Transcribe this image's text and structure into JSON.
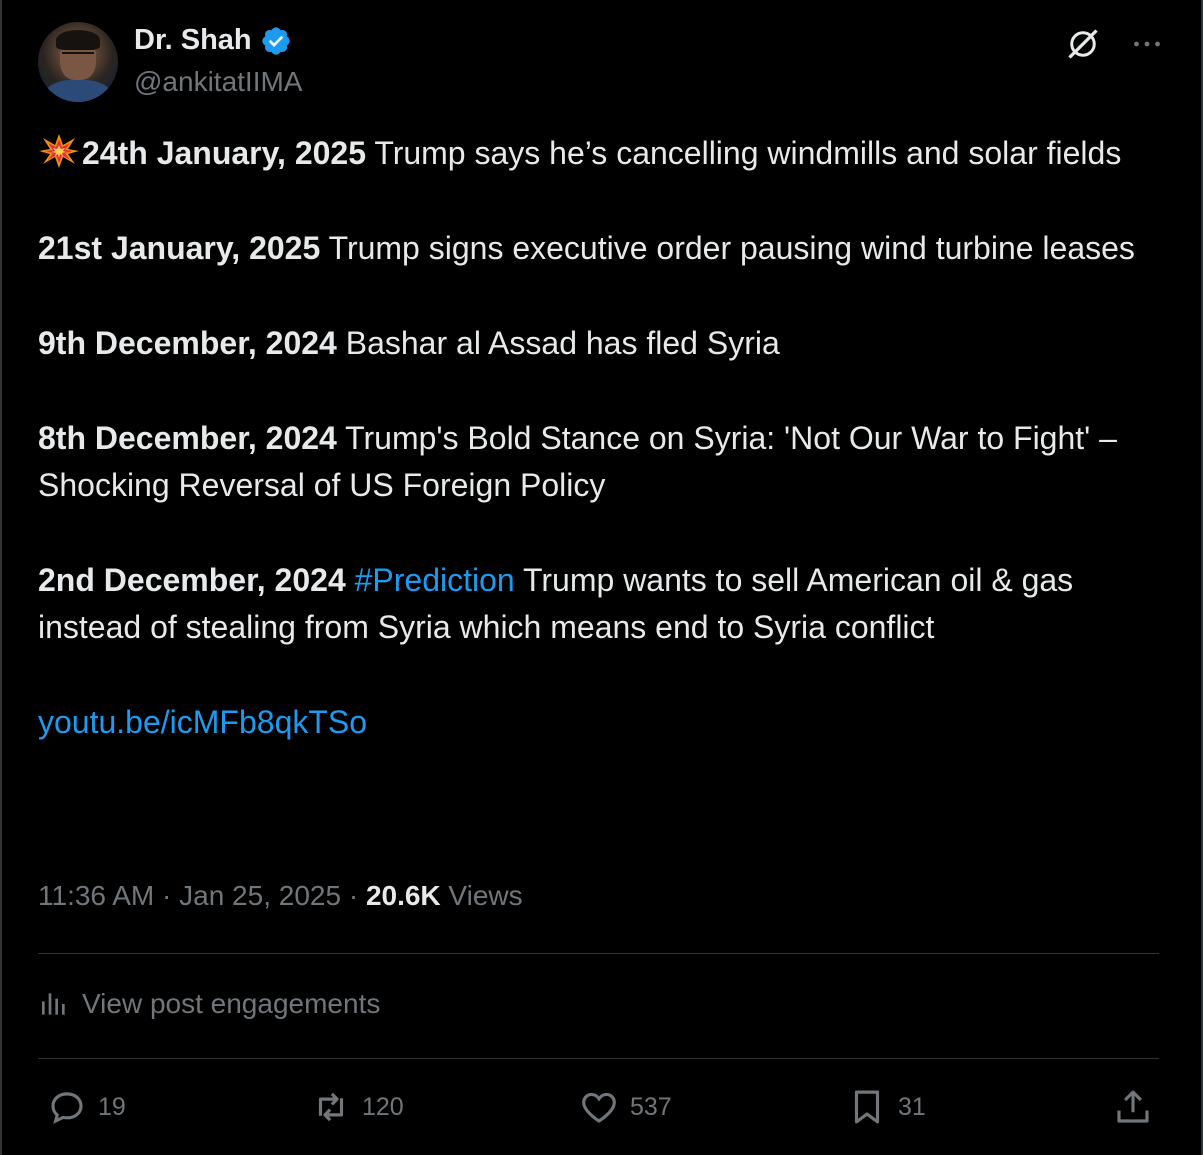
{
  "author": {
    "name": "Dr. Shah",
    "handle": "@ankitatIIMA",
    "verified": true
  },
  "header_icons": [
    "avatar",
    "verified-badge-icon",
    "grok-icon",
    "more-icon"
  ],
  "post": {
    "lines": [
      {
        "date": "24th January, 2025",
        "text": " Trump says he’s cancelling windmills and solar fields",
        "emoji": "collision"
      },
      {
        "date": "21st January, 2025",
        "text": " Trump signs executive order pausing wind turbine leases"
      },
      {
        "date": "9th December, 2024",
        "text": " Bashar al Assad has fled Syria"
      },
      {
        "date": "8th December, 2024",
        "text": " Trump's Bold Stance on Syria: 'Not Our War to Fight' – Shocking Reversal of US Foreign Policy"
      },
      {
        "date": "2nd December, 2024",
        "hashtag": " #Prediction",
        "text": " Trump wants to sell American oil & gas instead of stealing from Syria which means end to Syria conflict"
      }
    ],
    "link": "youtu.be/icMFb8qkTSo"
  },
  "meta": {
    "time": "11:36 AM",
    "sep1": " · ",
    "date": "Jan 25, 2025",
    "sep2": " · ",
    "views_count": "20.6K",
    "views_label": " Views"
  },
  "engagements_label": "View post engagements",
  "actions": {
    "replies": "19",
    "reposts": "120",
    "likes": "537",
    "bookmarks": "31"
  },
  "colors": {
    "background": "#000000",
    "text": "#e7e9ea",
    "secondary": "#71767b",
    "accent": "#1d9bf0",
    "divider": "#2f3336"
  }
}
